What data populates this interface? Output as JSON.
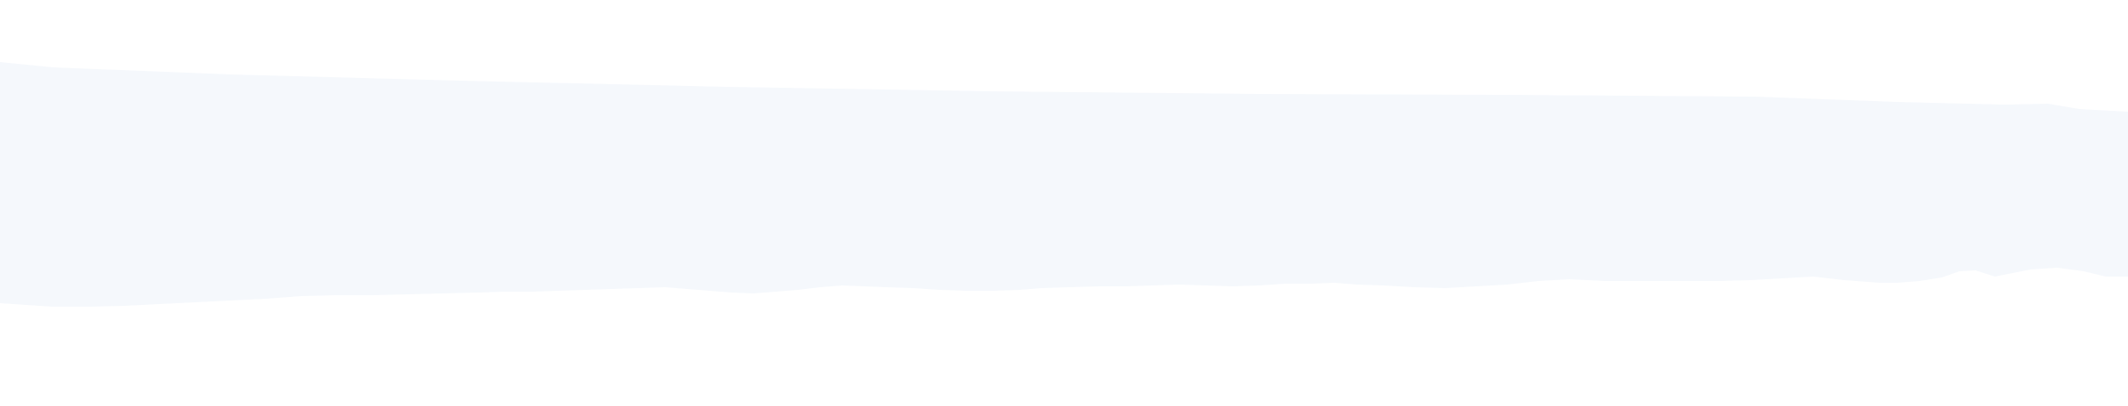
{
  "page": {
    "background_color": "#ffffff"
  },
  "band": {
    "fill_color": "#f5f8fc"
  }
}
